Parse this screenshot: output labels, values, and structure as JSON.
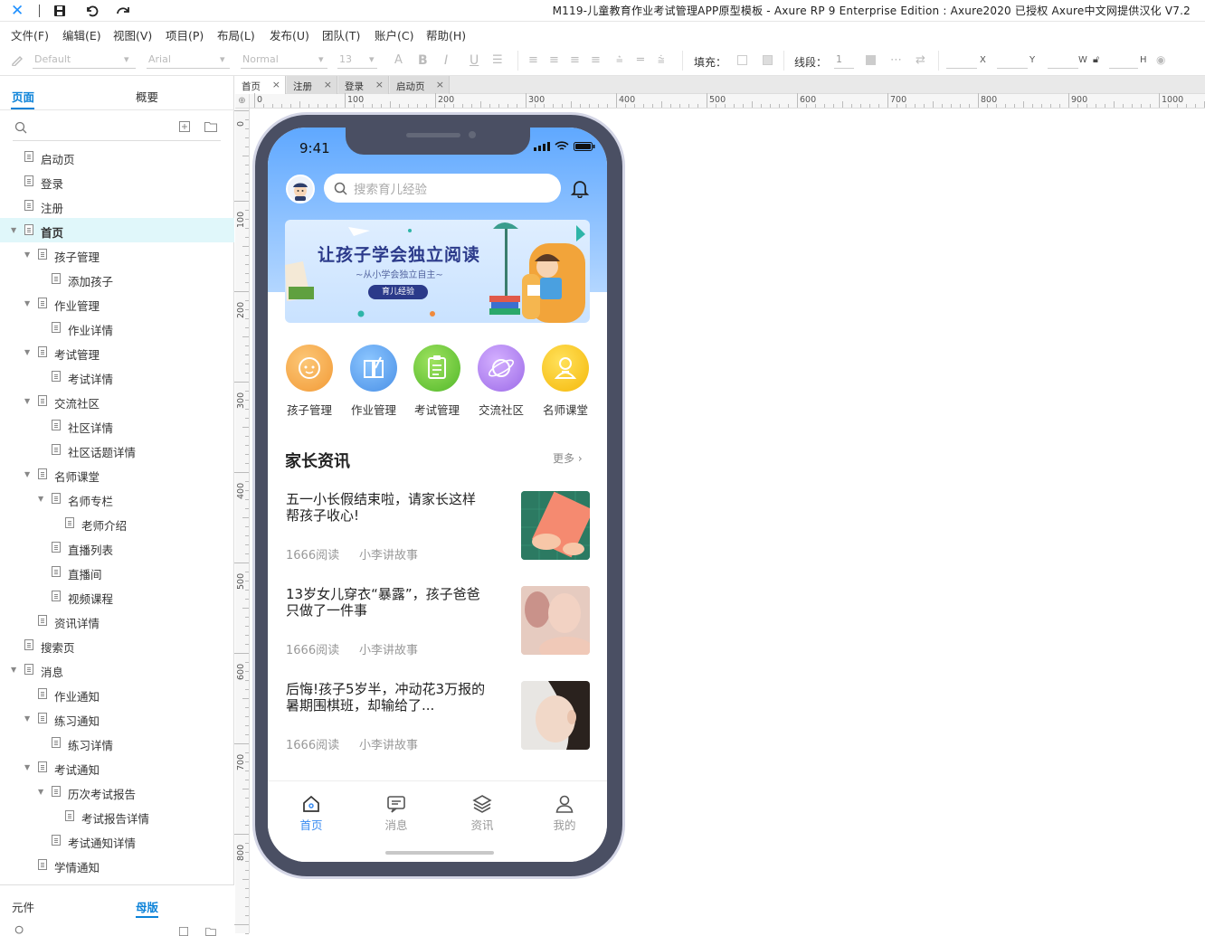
{
  "titlebar": {
    "title": "M119-儿童教育作业考试管理APP原型模板 - Axure RP 9 Enterprise Edition : Axure2020 已授权    Axure中文网提供汉化 V7.2"
  },
  "menu": [
    "文件(F)",
    "编辑(E)",
    "视图(V)",
    "项目(P)",
    "布局(L)",
    "发布(U)",
    "团队(T)",
    "账户(C)",
    "帮助(H)"
  ],
  "toolbar": {
    "style_select": "Default",
    "font_select": "Arial",
    "weight_select": "Normal",
    "size_select": "13",
    "fill_label": "填充：",
    "line_label": "线段：",
    "line_value": "1",
    "x_label": "X",
    "y_label": "Y",
    "w_label": "W",
    "h_label": "H"
  },
  "left_panel": {
    "tab_pages": "页面",
    "tab_outline": "概要",
    "tree": [
      {
        "label": "启动页",
        "level": 0,
        "expand": false
      },
      {
        "label": "登录",
        "level": 0,
        "expand": false
      },
      {
        "label": "注册",
        "level": 0,
        "expand": false
      },
      {
        "label": "首页",
        "level": 0,
        "expand": true,
        "selected": true
      },
      {
        "label": "孩子管理",
        "level": 1,
        "expand": true
      },
      {
        "label": "添加孩子",
        "level": 2,
        "expand": false
      },
      {
        "label": "作业管理",
        "level": 1,
        "expand": true
      },
      {
        "label": "作业详情",
        "level": 2,
        "expand": false
      },
      {
        "label": "考试管理",
        "level": 1,
        "expand": true
      },
      {
        "label": "考试详情",
        "level": 2,
        "expand": false
      },
      {
        "label": "交流社区",
        "level": 1,
        "expand": true
      },
      {
        "label": "社区详情",
        "level": 2,
        "expand": false
      },
      {
        "label": "社区话题详情",
        "level": 2,
        "expand": false
      },
      {
        "label": "名师课堂",
        "level": 1,
        "expand": true
      },
      {
        "label": "名师专栏",
        "level": 2,
        "expand": true
      },
      {
        "label": "老师介绍",
        "level": 3,
        "expand": false
      },
      {
        "label": "直播列表",
        "level": 2,
        "expand": false
      },
      {
        "label": "直播间",
        "level": 2,
        "expand": false
      },
      {
        "label": "视频课程",
        "level": 2,
        "expand": false
      },
      {
        "label": "资讯详情",
        "level": 1,
        "expand": false
      },
      {
        "label": "搜索页",
        "level": 0,
        "expand": false
      },
      {
        "label": "消息",
        "level": 0,
        "expand": true
      },
      {
        "label": "作业通知",
        "level": 1,
        "expand": false
      },
      {
        "label": "练习通知",
        "level": 1,
        "expand": true
      },
      {
        "label": "练习详情",
        "level": 2,
        "expand": false
      },
      {
        "label": "考试通知",
        "level": 1,
        "expand": true
      },
      {
        "label": "历次考试报告",
        "level": 2,
        "expand": true
      },
      {
        "label": "考试报告详情",
        "level": 3,
        "expand": false
      },
      {
        "label": "考试通知详情",
        "level": 2,
        "expand": false
      },
      {
        "label": "学情通知",
        "level": 1,
        "expand": false
      }
    ],
    "bottom_tab_widgets": "元件",
    "bottom_tab_masters": "母版"
  },
  "doc_tabs": [
    "首页",
    "注册",
    "登录",
    "启动页"
  ],
  "ruler": {
    "h": [
      "0",
      "100",
      "200",
      "300",
      "400",
      "500",
      "600",
      "700",
      "800",
      "900",
      "1000"
    ],
    "v": [
      "0",
      "100",
      "200",
      "300",
      "400",
      "500",
      "600",
      "700",
      "800"
    ]
  },
  "app": {
    "time": "9:41",
    "search_placeholder": "搜索育儿经验",
    "banner": {
      "title": "让孩子学会独立阅读",
      "subtitle": "~从小学会独立自主~",
      "button": "育儿经验"
    },
    "quick": [
      {
        "label": "孩子管理",
        "color": "#f7a94a",
        "icon": "child-face-icon"
      },
      {
        "label": "作业管理",
        "color": "#5aa2ee",
        "icon": "book-pen-icon"
      },
      {
        "label": "考试管理",
        "color": "#6fcf3a",
        "icon": "clipboard-icon"
      },
      {
        "label": "交流社区",
        "color": "#b37ef0",
        "icon": "planet-icon"
      },
      {
        "label": "名师课堂",
        "color": "#f7c61a",
        "icon": "teacher-icon"
      }
    ],
    "section_title": "家长资讯",
    "more": "更多",
    "news": [
      {
        "title": "五一小长假结束啦，请家长这样帮孩子收心!",
        "reads": "1666阅读",
        "author": "小李讲故事"
      },
      {
        "title": "13岁女儿穿衣“暴露”，孩子爸爸只做了一件事",
        "reads": "1666阅读",
        "author": "小李讲故事"
      },
      {
        "title": "后悔!孩子5岁半，冲动花3万报的暑期围棋班，却输给了...",
        "reads": "1666阅读",
        "author": "小李讲故事"
      }
    ],
    "tabs": [
      {
        "label": "首页",
        "icon": "home-icon",
        "active": true
      },
      {
        "label": "消息",
        "icon": "message-icon",
        "active": false
      },
      {
        "label": "资讯",
        "icon": "layers-icon",
        "active": false
      },
      {
        "label": "我的",
        "icon": "user-icon",
        "active": false
      }
    ],
    "colors": {
      "accent": "#3b8cf0",
      "brand_blue": "#5fa8ff"
    }
  }
}
